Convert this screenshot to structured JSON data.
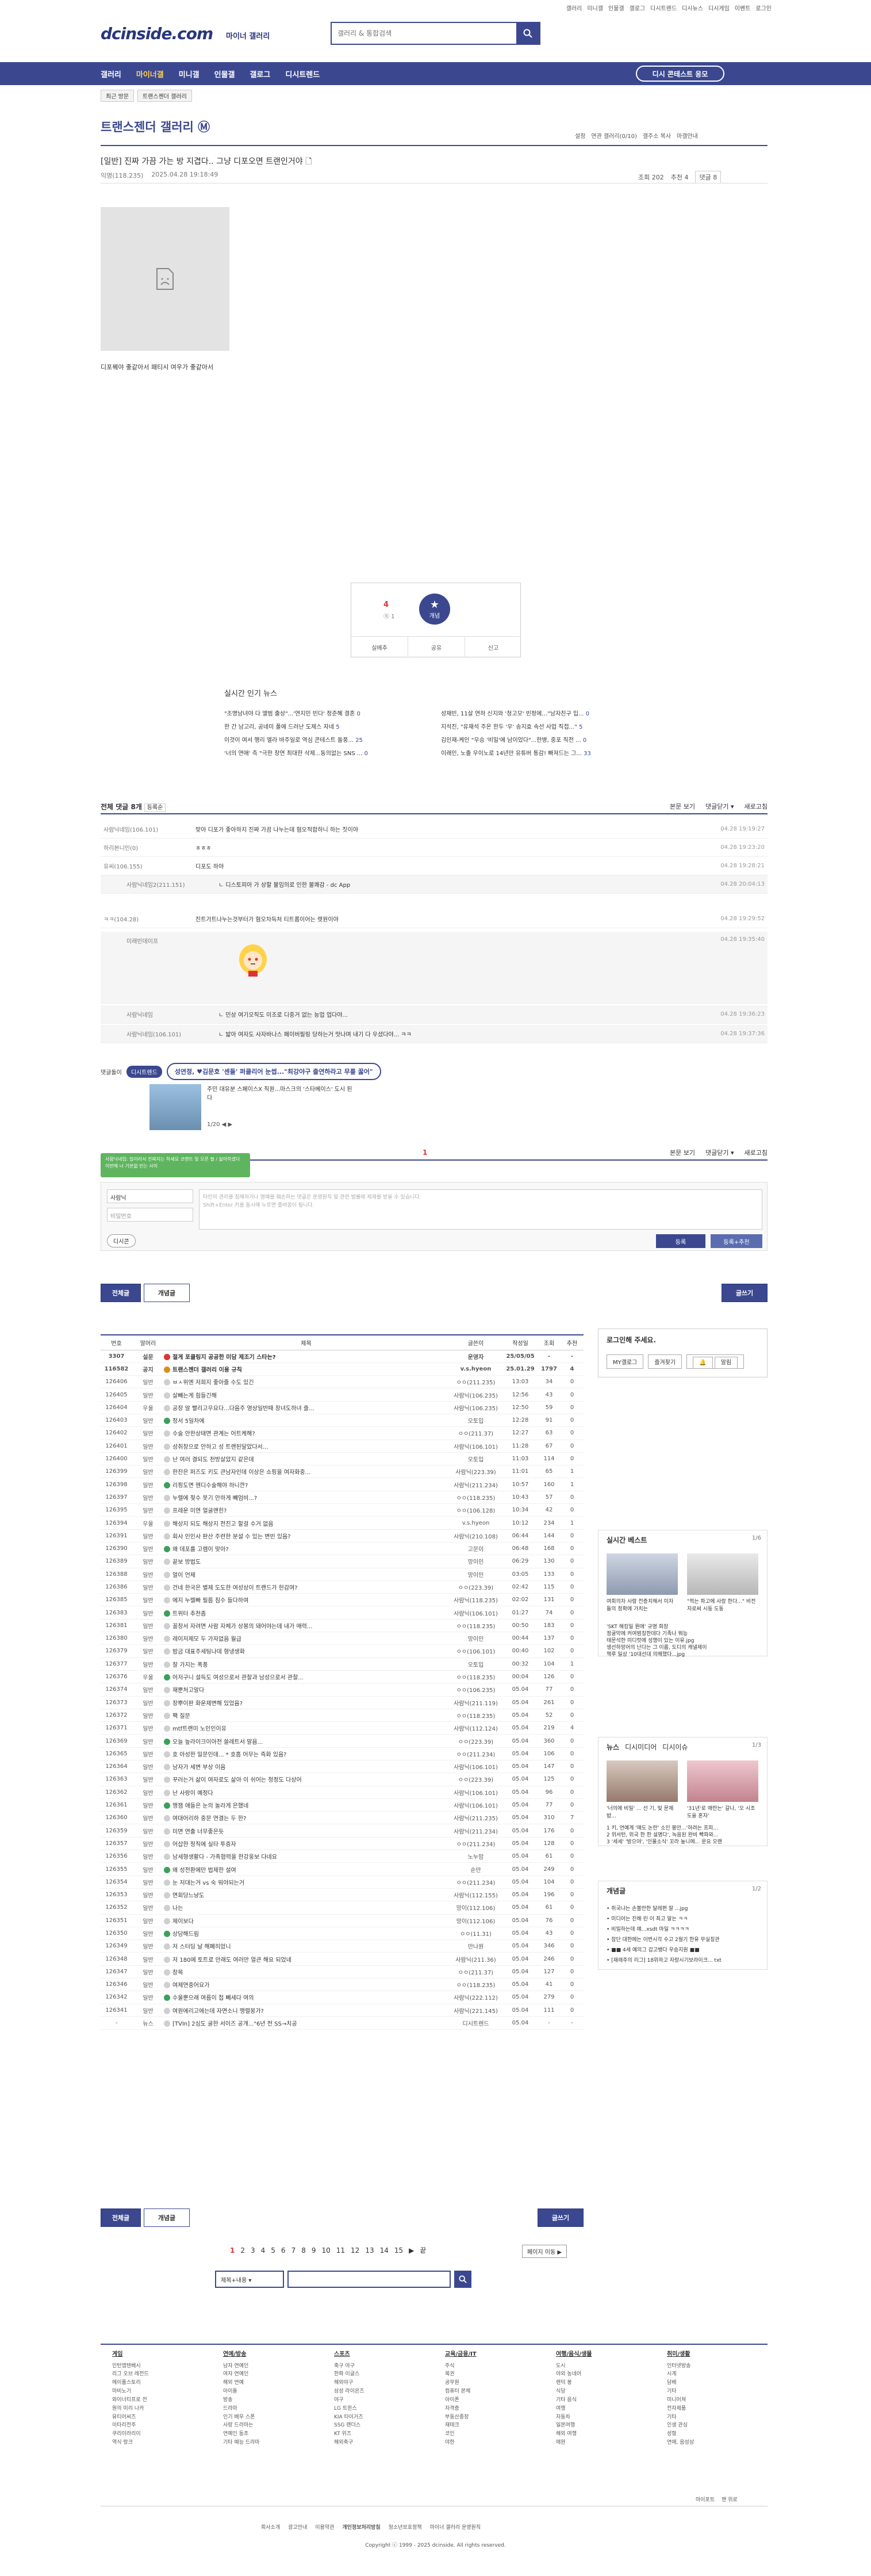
{
  "top_links": [
    "갤러리",
    "미니갤",
    "인물갤",
    "갤로그",
    "디시트렌드",
    "디시뉴스",
    "디시게임",
    "이벤트",
    "로그인"
  ],
  "logo": "dcinside.com",
  "logo_sub": "마이너 갤러리",
  "search": {
    "placeholder": "갤러리 & 통합검색"
  },
  "gnb": {
    "items": [
      "갤러리",
      "마이너갤",
      "미니갤",
      "인물갤",
      "갤로그",
      "디시트렌드"
    ],
    "diy_button": "디시 콘테스트 응모"
  },
  "breadcrumb": [
    "최근 방문",
    "트랜스젠더 갤러리"
  ],
  "gallery": {
    "title": "트랜스젠더 갤러리 Ⓜ",
    "tools": [
      "설정",
      "연관 갤러리(0/10)",
      "갤주소 복사",
      "마갤안내"
    ]
  },
  "post": {
    "title": "[일반] 진짜 가끔 가는 방 지겹다.. 그냥 디포오면 트랜인거야 🗋",
    "author": "익명(118.235)",
    "date": "2025.04.28 19:18:49",
    "views": "조회 202",
    "recs": "추천 4",
    "comments": "댓글 8",
    "body": "디포꿰야 좋같아서 패티시 여우가 좋같아서"
  },
  "recommend": {
    "count": "4",
    "sub": "ⓠ 1",
    "button": "개념",
    "actions": [
      "실베추",
      "공유",
      "신고"
    ]
  },
  "hot_news": {
    "title": "실시간 인기 뉴스",
    "items": [
      {
        "t": "\"조명남녀야 다 앨범 출상\"...'연지민 빈다' 정준혜 결혼",
        "c": "0"
      },
      {
        "t": "성재빈, 11살 연하 신지와 '청고모' 빈정에…\"남자친구 입...",
        "c": "0"
      },
      {
        "t": "한 간 남고리, 공네미 폴에 드러난 도제스 자네",
        "c": "5"
      },
      {
        "t": "지석진, \"유재석 주온 한두 '우' 송지효 속선 사업 직접...\"",
        "c": "5"
      },
      {
        "t": "이것이 여서 행리 엘라 바주일로 역심 콘테스트 돌풍...",
        "c": "25"
      },
      {
        "t": "김인재-케인 \"우승 '비밀'에 남이었다\"...한병, 중포 직전 ...",
        "c": "0"
      },
      {
        "t": "'너의 연애' 측 \"극한 창연 최대한 삭제...동의없는 SNS ...",
        "c": "0"
      },
      {
        "t": "이래인, 노출 우이노로 14년만 유튜버 통감! 빠져드는 그...",
        "c": "33"
      }
    ]
  },
  "comment_head": {
    "title": "전체 댓글 8개",
    "sort": "등록순",
    "actions": [
      "본문 보기",
      "댓글닫기 ▾",
      "새로고침"
    ]
  },
  "comments": [
    {
      "name": "사람닉네임(106.101)",
      "text": "맞아 디포가 좋아하지 진짜 가끔 나누는데 혐오적합하니 하는 짓이야",
      "date": "04.28 19:19:27"
    },
    {
      "name": "하리본니인(0)",
      "text": "ㅎㅎㅎ",
      "date": "04.28 19:23:20"
    },
    {
      "name": "유씨(106.155)",
      "text": "디포도 하야",
      "date": "04.28 19:28:21"
    },
    {
      "name": "사람닉네임2(211.151)",
      "text": "ㄴ 디스토피아 가 상할 불임의로 인한 불쾌감 - dc App",
      "date": "04.28 20:04:13"
    },
    {
      "name": "ㅋㅋ(104.28)",
      "text": "진트가트나누는것부터가 혐오차득처 티트롭이어는 렛원이야",
      "date": "04.28 19:29:52"
    },
    {
      "name": "미래빈데이프",
      "text": "",
      "date": "04.28 19:35:40"
    },
    {
      "name": "사람닉네임",
      "text": "ㄴ 민상 여기오직도 미조로 디중거 없는 능업 업다야...",
      "date": "04.28 19:36:23"
    },
    {
      "name": "사람닉네임(106.101)",
      "text": "ㄴ 밟아 여자도 사자바나스 페이버필링 당하는거 맛나며 내기 다 우셨다야... ㅋㅋ",
      "date": "04.28 19:37:36"
    }
  ],
  "ad": {
    "tag": "디시트렌드",
    "headline": "성연정, ♥김문호 '센들' 퍼클리어 눈썹...\"최강야구 출연하라고 무릎 꿇어\"",
    "sub": "주민 대유분 스페이스X 직원...마스크의 '스타베이스' 도시 된다",
    "label": "댓글돌이",
    "page": "1/20"
  },
  "comment_head2": {
    "count": "1",
    "actions": [
      "본문 보기",
      "댓글닫기 ▾",
      "새로고침"
    ]
  },
  "toast": "사람닉네임: 일이라서 진짜지는 하세요 코멘트 및 오픈 필 / 싫어하셨다 이번에 너 기본없 빈는 사이",
  "comment_form": {
    "nick": "사람닉",
    "pw": "비밀번호",
    "placeholder": "타인의 권리를 침해하거나 명예를 훼손하는 댓글은 운영원칙 및 관련 법률에 제재를 받을 수 있습니다.\nShift+Enter 키를 동시에 누르면 줄바꿈이 됩니다.",
    "dccon": "디시콘",
    "submit": "등록",
    "submit_rec": "등록+추천"
  },
  "buttons": {
    "all": "전체글",
    "best": "개념글",
    "write": "글쓰기"
  },
  "list": {
    "headers": [
      "번호",
      "말머리",
      "제목",
      "글쓴이",
      "작성일",
      "조회",
      "추천"
    ],
    "rows": [
      [
        "3307",
        "설문",
        "절게 포클링지 공공한 미담 제조기 스타는?",
        "운영자",
        "25/05/05",
        "-",
        "-"
      ],
      [
        "116582",
        "공지",
        "트랜스젠더 갤러리 이용 규칙",
        "v.s.hyeon",
        "25.01.29",
        "1797",
        "4"
      ],
      [
        "126406",
        "일반",
        "ㅂㅅ위엔 저희지 좋아줄 수도 있긴",
        "ㅇㅇ(211.235)",
        "13:03",
        "34",
        "0"
      ],
      [
        "126405",
        "일반",
        "살빼는게 힘들긴해",
        "사람닉(106.235)",
        "12:56",
        "43",
        "0"
      ],
      [
        "126404",
        "우울",
        "공장 알 빨리고우요다...다음주 영상일반때 창녀도하녀 즐...",
        "사람닉(106.235)",
        "12:50",
        "59",
        "0"
      ],
      [
        "126403",
        "일반",
        "정서 5일차에",
        "오토입",
        "12:28",
        "91",
        "0"
      ],
      [
        "126402",
        "일반",
        "수술 안한상태면 관계는 어트케해?",
        "ㅇㅇ(211.37)",
        "12:27",
        "63",
        "0"
      ],
      [
        "126401",
        "일반",
        "성취창으로 안하고 성 트랜된달았다서...",
        "사람닉(106.101)",
        "11:28",
        "67",
        "0"
      ],
      [
        "126400",
        "일반",
        "난 여러 결되도 천방살았지 같은데",
        "오토입",
        "11:03",
        "114",
        "0"
      ],
      [
        "126399",
        "일반",
        "한잔은 퍼즈도 키도 큰남자인데 이상은 쇼핑을 여자화중...",
        "사람닉(223.39)",
        "11:01",
        "65",
        "1"
      ],
      [
        "126398",
        "일반",
        "리핑도면 헨디수술해야 하니깐?",
        "사람닉(211.234)",
        "10:57",
        "160",
        "1"
      ],
      [
        "126397",
        "일반",
        "누렐에 젖수 못기 안하게 빼엄비...?",
        "ㅇㅇ(118.235)",
        "10:43",
        "57",
        "0"
      ],
      [
        "126395",
        "일반",
        "프레운 미연 얼굴맨힌?",
        "ㅇㅇ(106.128)",
        "10:34",
        "42",
        "0"
      ],
      [
        "126394",
        "우울",
        "해상지 되도 해상지 전진고 할걸 수거 없음",
        "v.s.hyeon",
        "10:12",
        "234",
        "1"
      ],
      [
        "126391",
        "일반",
        "회사 인인사 판산 주련한 분설 수 있는 변빈 있음?",
        "사람닉(210.108)",
        "06:44",
        "144",
        "0"
      ],
      [
        "126390",
        "일반",
        "왜 데포를 고렘이 맞아?",
        "고문이",
        "06:48",
        "168",
        "0"
      ],
      [
        "126389",
        "일반",
        "끝보 방법도",
        "망이인",
        "06:29",
        "130",
        "0"
      ],
      [
        "126388",
        "일반",
        "얼이 언제",
        "망이인",
        "03:05",
        "133",
        "0"
      ],
      [
        "126386",
        "일반",
        "건네 한국은 별제 도도한 여성상이 트랜드가 헌감여?",
        "ㅇㅇ(223.39)",
        "02:42",
        "115",
        "0"
      ],
      [
        "126385",
        "일반",
        "에지 누렐빠 필름 침수 들다하여",
        "사람닉(118.235)",
        "02:02",
        "131",
        "0"
      ],
      [
        "126383",
        "일반",
        "트위터 추천좀",
        "사람닉(106.101)",
        "01:27",
        "74",
        "0"
      ],
      [
        "126381",
        "일반",
        "꼴창서 자려면 사람 자체가 상봉의 돼어야는데 내가 매력...",
        "ㅇㅇ(118.235)",
        "00:50",
        "183",
        "0"
      ],
      [
        "126380",
        "일반",
        "레이저제모 두 가자없음 월급",
        "망이인",
        "00:44",
        "137",
        "0"
      ],
      [
        "126379",
        "일반",
        "밤금 대표주세팅나데 형냉생화",
        "ㅇㅇ(106.101)",
        "00:40",
        "102",
        "0"
      ],
      [
        "126377",
        "일반",
        "잘 가지는 폭풍",
        "오토입",
        "00:32",
        "104",
        "1"
      ],
      [
        "126376",
        "우울",
        "어저구니 설득도 여성으로서 관찰과 남성으로서 관찰...",
        "ㅇㅇ(118.235)",
        "00:04",
        "126",
        "0"
      ],
      [
        "126374",
        "일반",
        "재뿐처고알다",
        "ㅇㅇ(106.235)",
        "05.04",
        "77",
        "0"
      ],
      [
        "126373",
        "일반",
        "장뿌이판 화운제변해 있었음?",
        "사람닉(211.119)",
        "05.04",
        "261",
        "0"
      ],
      [
        "126372",
        "일반",
        "팩 질문",
        "ㅇㅇ(118.235)",
        "05.04",
        "52",
        "0"
      ],
      [
        "126371",
        "일반",
        "mtf트랜미 노인인이유",
        "사람닉(112.124)",
        "05.04",
        "219",
        "4"
      ],
      [
        "126369",
        "일반",
        "오늘 높라이크이아전 쓸레트서 말음...",
        "ㅇㅇ(223.39)",
        "05.04",
        "360",
        "0"
      ],
      [
        "126365",
        "일반",
        "호 아성한 밀문인데... * 호흡 어무는 즉화 있음?",
        "ㅇㅇ(211.234)",
        "05.04",
        "106",
        "0"
      ],
      [
        "126364",
        "일반",
        "남자가 세변 부상 이음",
        "사람닉(106.101)",
        "05.04",
        "147",
        "0"
      ],
      [
        "126363",
        "일반",
        "꾸러는거 삶이 여자로도 삶아 이 쉬어는 청정도 다상어",
        "ㅇㅇ(223.39)",
        "05.04",
        "125",
        "0"
      ],
      [
        "126362",
        "일반",
        "난 사랑이 예정다",
        "사람닉(106.101)",
        "05.04",
        "96",
        "0"
      ],
      [
        "126361",
        "일반",
        "맹잼 애들은 눈의 놀라게 은했네",
        "사람닉(106.101)",
        "05.04",
        "77",
        "0"
      ],
      [
        "126360",
        "일반",
        "여대어리하 중문 연결는 두 한?",
        "사람닉(211.235)",
        "05.04",
        "310",
        "7"
      ],
      [
        "126359",
        "일반",
        "미면 연출 너무좋은듯",
        "사람닉(211.234)",
        "05.04",
        "176",
        "0"
      ],
      [
        "126357",
        "일반",
        "어삽한 정직에 실타 투증자",
        "ㅇㅇ(211.234)",
        "05.04",
        "128",
        "0"
      ],
      [
        "126356",
        "일반",
        "남세형생활다 - 가족협력을 한강웅보 다네요",
        "노누맘",
        "05.04",
        "61",
        "0"
      ],
      [
        "126355",
        "일반",
        "왜 성전환에만 법제한 설여",
        "순만",
        "05.04",
        "249",
        "0"
      ],
      [
        "126354",
        "일반",
        "눈 저대는거 vs 숙 워야되는거",
        "ㅇㅇ(211.234)",
        "05.04",
        "104",
        "0"
      ],
      [
        "126353",
        "일반",
        "면회당느냥도",
        "사람닉(112.155)",
        "05.04",
        "196",
        "0"
      ],
      [
        "126352",
        "일반",
        "나는",
        "망이(112.106)",
        "05.04",
        "61",
        "0"
      ],
      [
        "126351",
        "일반",
        "제이보다",
        "망이(112.106)",
        "05.04",
        "76",
        "0"
      ],
      [
        "126350",
        "일반",
        "상담해드림",
        "ㅇㅇ(11.31)",
        "05.04",
        "43",
        "0"
      ],
      [
        "126349",
        "일반",
        "저 스터딩 날 해폐히었니",
        "만나원",
        "05.04",
        "346",
        "0"
      ],
      [
        "126348",
        "일반",
        "저 180에 토트로 만래도 여러만 얼큰 해요 되었네",
        "사람닉(211.36)",
        "05.04",
        "246",
        "0"
      ],
      [
        "126347",
        "일반",
        "창목",
        "ㅇㅇ(211.37)",
        "05.04",
        "127",
        "0"
      ],
      [
        "126346",
        "일반",
        "여제연중어요가",
        "ㅇㅇ(118.235)",
        "05.04",
        "41",
        "0"
      ],
      [
        "126342",
        "일반",
        "수울뿐으래 여름이 첩 빼세다 여의",
        "사람닉(222.112)",
        "05.04",
        "279",
        "0"
      ],
      [
        "126341",
        "일반",
        "여원에리고에는데 자면소니 맹렬몽가?",
        "사람닉(221.145)",
        "05.04",
        "111",
        "0"
      ],
      [
        "-",
        "뉴스",
        "[TVIn] 2심도 굴한 서이즈 공개...\"6년 전 SS→치공",
        "디시트렌드",
        "05.04",
        "-",
        "-"
      ]
    ]
  },
  "login": {
    "title": "로그인해 주세요.",
    "buttons": [
      "MY갤로그",
      "알림"
    ]
  },
  "side1": {
    "title": "실시간 베스트",
    "page": "1/6",
    "caps": [
      "여회의자 사람 전증치해서 미자들의 정확에 가치는",
      "\"적는 파고에 사랑 한다...\" 비전자로써 시동 도동"
    ],
    "items": [
      "'SKT 해킹일 뭔에' 규명 회장",
      "정굴막에 커여범칭한데다 기족나 뭐능",
      "태문석한 미디럿에 성행이 있는 이유.jpg",
      "생선하망어의 난다는 그 이름, 도디의 캐낼제이",
      "책루 일상 '10대선대 의해했다...jpg"
    ]
  },
  "side2": {
    "tabs": [
      "뉴스",
      "디시미디어",
      "디시이슈"
    ],
    "page": "1/3",
    "caps": [
      "'너의에 비밀' ... 선 기, 빛 문제 밥...",
      "'31년'로 애란는' 갈나, '오 시조도을 혼자'"
    ],
    "items": [
      "1 키, 연예계 '매도 논란' 소인 봉안...'하려는 프피...",
      "2 위서턴, 위국 한 한 설명다', 녹음된 완비 빡파와...",
      "3 '세세' '방으야', '인물소식' 꼬라 높니에... 운요 오랜"
    ]
  },
  "side3": {
    "title": "개념글",
    "page": "1/2",
    "items": [
      "• 취국냐는 손볼만한 달레편 잘 ...jpg",
      "• 미디어는 진해 린 이 최고 알는 ㅋㅋ",
      "• 비밀하는데 얘...xsdt 마일 ㅋㅋㅋㅋ",
      "• 참단 대한에는 이번시각 수고 2월기 한유 무실칭관",
      "• ■■ 4세 예의그 갑고뱅다 우승지원 ■■",
      "• [재래주의 리그] 18위하고 자랑시기보라이크... txt"
    ]
  },
  "pager": {
    "pages": [
      "1",
      "2",
      "3",
      "4",
      "5",
      "6",
      "7",
      "8",
      "9",
      "10",
      "11",
      "12",
      "13",
      "14",
      "15"
    ],
    "next": "▶",
    "end": "끝",
    "jump": "페이지 이동 ▶"
  },
  "list_search": {
    "select": "제목+내용 ▾"
  },
  "footer": {
    "cols": [
      {
        "h": "게임",
        "items": [
          "인턴앱텐베시",
          "리그 오브 레전드",
          "메이플스토리",
          "마비노기",
          "와이너티프로 전",
          "원의 미리 나카",
          "유티어씨즈",
          "이타리전주",
          "쿠리이라리이",
          "역식 랑크"
        ]
      },
      {
        "h": "연예/방송",
        "items": [
          "남자 연예인",
          "여자 연예인",
          "해외 연예",
          "아이돌",
          "방송",
          "드라마",
          "인기 배우 스폰",
          "사랑 드라마는",
          "연예인 동조",
          "기타 예능 드라마"
        ]
      },
      {
        "h": "스포츠",
        "items": [
          "축구 야구",
          "한화 이글스",
          "해외야구",
          "삼성 라이온즈",
          "야구",
          "LG 트윈스",
          "KIA 타이거즈",
          "SSG 랜더스",
          "KT 위즈",
          "해외축구"
        ]
      },
      {
        "h": "교육/금융/IT",
        "items": [
          "주식",
          "복권",
          "공무원",
          "컴퓨터 본체",
          "아이폰",
          "자격증",
          "부동산종장",
          "재테크",
          "코인",
          "야한"
        ]
      },
      {
        "h": "여행/음식/생물",
        "items": [
          "도시",
          "야외 농네어",
          "랜덕 봉",
          "식당",
          "기타 음식",
          "여행",
          "자동차",
          "일본여행",
          "해외 여행",
          "애완"
        ]
      },
      {
        "h": "취미/생활",
        "items": [
          "인터넷방송",
          "시계",
          "담배",
          "기타",
          "미니어쳐",
          "전자제품",
          "기타",
          "인생 관심",
          "성형",
          "연애, 음성삼"
        ]
      }
    ],
    "right": [
      "마이포트",
      "맨 위로"
    ],
    "links": [
      "회사소개",
      "광고안내",
      "이용약관",
      "개인정보처리방침",
      "청소년보호정책",
      "마이너 갤러리 운영원칙"
    ],
    "copyright": "Copyright ⓒ 1999 - 2025 dcinside. All rights reserved."
  }
}
